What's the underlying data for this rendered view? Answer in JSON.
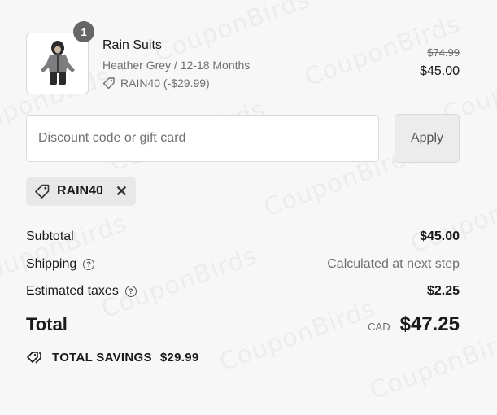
{
  "watermark": "CouponBirds",
  "item": {
    "quantity": "1",
    "name": "Rain Suits",
    "variant": "Heather Grey / 12-18 Months",
    "discount_tag": "RAIN40 (-$29.99)",
    "original_price": "$74.99",
    "price": "$45.00",
    "thumbnail": "snowsuit-image"
  },
  "discount": {
    "placeholder": "Discount code or gift card",
    "apply_label": "Apply",
    "applied_code": "RAIN40"
  },
  "summary": {
    "subtotal_label": "Subtotal",
    "subtotal_value": "$45.00",
    "shipping_label": "Shipping",
    "shipping_value": "Calculated at next step",
    "taxes_label": "Estimated taxes",
    "taxes_value": "$2.25",
    "total_label": "Total",
    "currency": "CAD",
    "total_value": "$47.25",
    "savings_label": "TOTAL SAVINGS",
    "savings_value": "$29.99"
  }
}
